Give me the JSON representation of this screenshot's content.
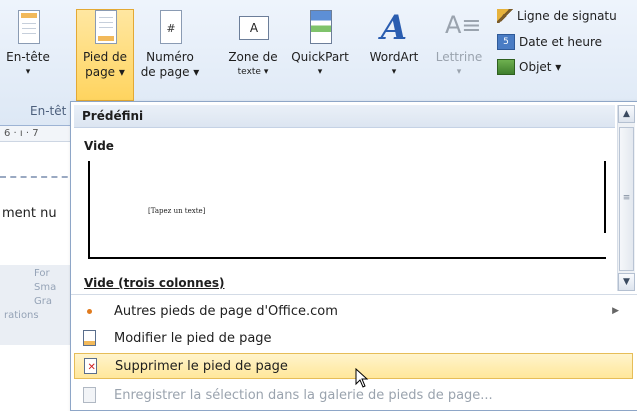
{
  "ribbon": {
    "buttons": [
      {
        "line1": "En-tête",
        "line2": "▾"
      },
      {
        "line1": "Pied de",
        "line2": "page ▾"
      },
      {
        "line1": "Numéro",
        "line2": "de page ▾"
      },
      {
        "line1": "Zone de",
        "line2": "texte ▾"
      },
      {
        "line1": "QuickPart",
        "line2": "▾"
      },
      {
        "line1": "WordArt",
        "line2": "▾"
      },
      {
        "line1": "Lettrine",
        "line2": "▾"
      }
    ],
    "small_buttons": [
      "Ligne de signatu",
      "Date et heure",
      "Objet ▾"
    ],
    "group_label": "En-têt"
  },
  "document": {
    "ruler": "6 · ı · 7",
    "text": "ment nu",
    "faded_items": [
      "For",
      "Sma",
      "Gra",
      "rations"
    ]
  },
  "dropdown": {
    "header": "Prédéfini",
    "section1": "Vide",
    "placeholder": "[Tapez un texte]",
    "section2": "Vide (trois colonnes)",
    "menu": [
      {
        "label": "Autres pieds de page d'Office.com",
        "icon": "bullet-icon",
        "submenu": true
      },
      {
        "label": "Modifier le pied de page",
        "icon": "edit-footer-icon"
      },
      {
        "label": "Supprimer le pied de page",
        "icon": "delete-footer-icon"
      },
      {
        "label": "Enregistrer la sélection dans la galerie de pieds de page...",
        "icon": "save-selection-icon"
      }
    ]
  },
  "colors": {
    "accent": "#ffd45f",
    "hover": "#ffe79b",
    "border": "#8ea6c7"
  }
}
